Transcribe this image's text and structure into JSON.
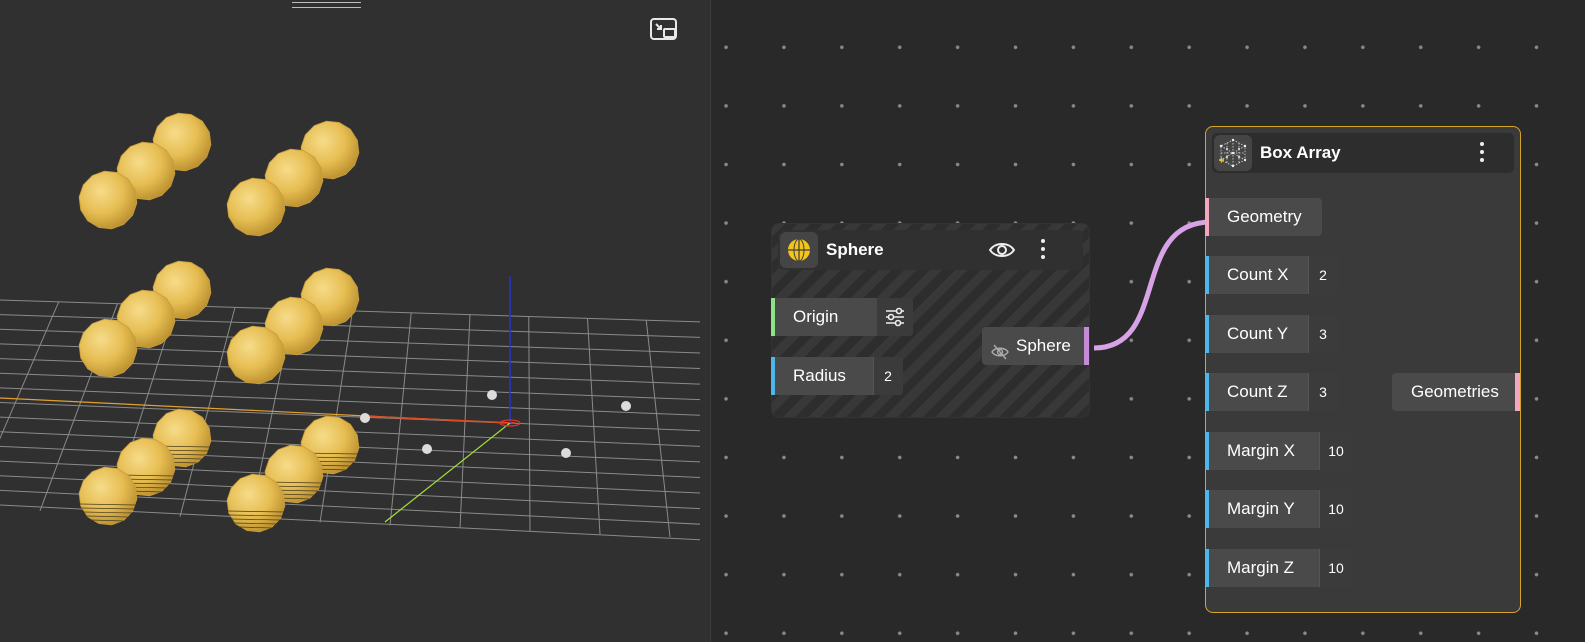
{
  "viewport": {
    "sphere_color": "#e9c158",
    "pip_icon": "picture-in-picture-icon"
  },
  "sphere_node": {
    "title": "Sphere",
    "icon": "sphere-icon",
    "visibility_icon": "eye-icon",
    "menu_icon": "more-vertical-icon",
    "inputs": [
      {
        "label": "Origin",
        "icon": "sliders-icon",
        "color": "#8de38a"
      },
      {
        "label": "Radius",
        "value": "2",
        "color": "#4fb6ec"
      }
    ],
    "output": {
      "label": "Sphere",
      "icon": "eye-off-icon",
      "color": "#c58ad8"
    }
  },
  "box_node": {
    "title": "Box Array",
    "icon": "box-array-icon",
    "menu_icon": "more-vertical-icon",
    "border_color": "#d4a52a",
    "inputs": [
      {
        "label": "Geometry",
        "color": "#f2a6bf"
      },
      {
        "label": "Count X",
        "value": "2",
        "color": "#4fb6ec"
      },
      {
        "label": "Count Y",
        "value": "3",
        "color": "#4fb6ec"
      },
      {
        "label": "Count Z",
        "value": "3",
        "color": "#4fb6ec"
      },
      {
        "label": "Margin X",
        "value": "10",
        "color": "#4fb6ec"
      },
      {
        "label": "Margin Y",
        "value": "10",
        "color": "#4fb6ec"
      },
      {
        "label": "Margin Z",
        "value": "10",
        "color": "#4fb6ec"
      }
    ],
    "output": {
      "label": "Geometries",
      "color": "#f2a6bf"
    }
  },
  "wire_color": "#d7a3e6"
}
